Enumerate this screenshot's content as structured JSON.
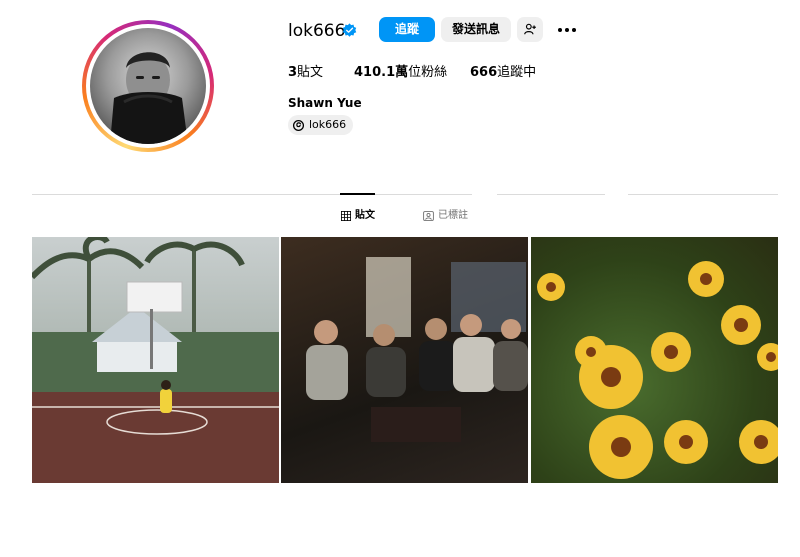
{
  "profile": {
    "username": "lok666",
    "full_name": "Shawn Yue",
    "threads_handle": "lok666",
    "verified_badge_color": "#0095f6"
  },
  "actions": {
    "follow_label": "追蹤",
    "message_label": "發送訊息",
    "add_user_icon": "person-add-icon",
    "more_icon": "more-horizontal-icon"
  },
  "stats": {
    "posts": {
      "count": "3",
      "label": "貼文"
    },
    "followers": {
      "count": "410.1萬",
      "label": "位粉絲"
    },
    "following": {
      "count": "666",
      "label": "追蹤中"
    }
  },
  "tabs": [
    {
      "label": "貼文",
      "icon": "grid-icon",
      "active": true
    },
    {
      "label": "已標註",
      "icon": "tagged-icon",
      "active": false
    }
  ],
  "posts": [
    {
      "subject": "basketball court with child in yellow",
      "dominant_color": "#6d3c35"
    },
    {
      "subject": "group of men sitting in a room",
      "dominant_color": "#2d2520"
    },
    {
      "subject": "yellow daisy flowers",
      "dominant_color": "#f1c232"
    }
  ]
}
